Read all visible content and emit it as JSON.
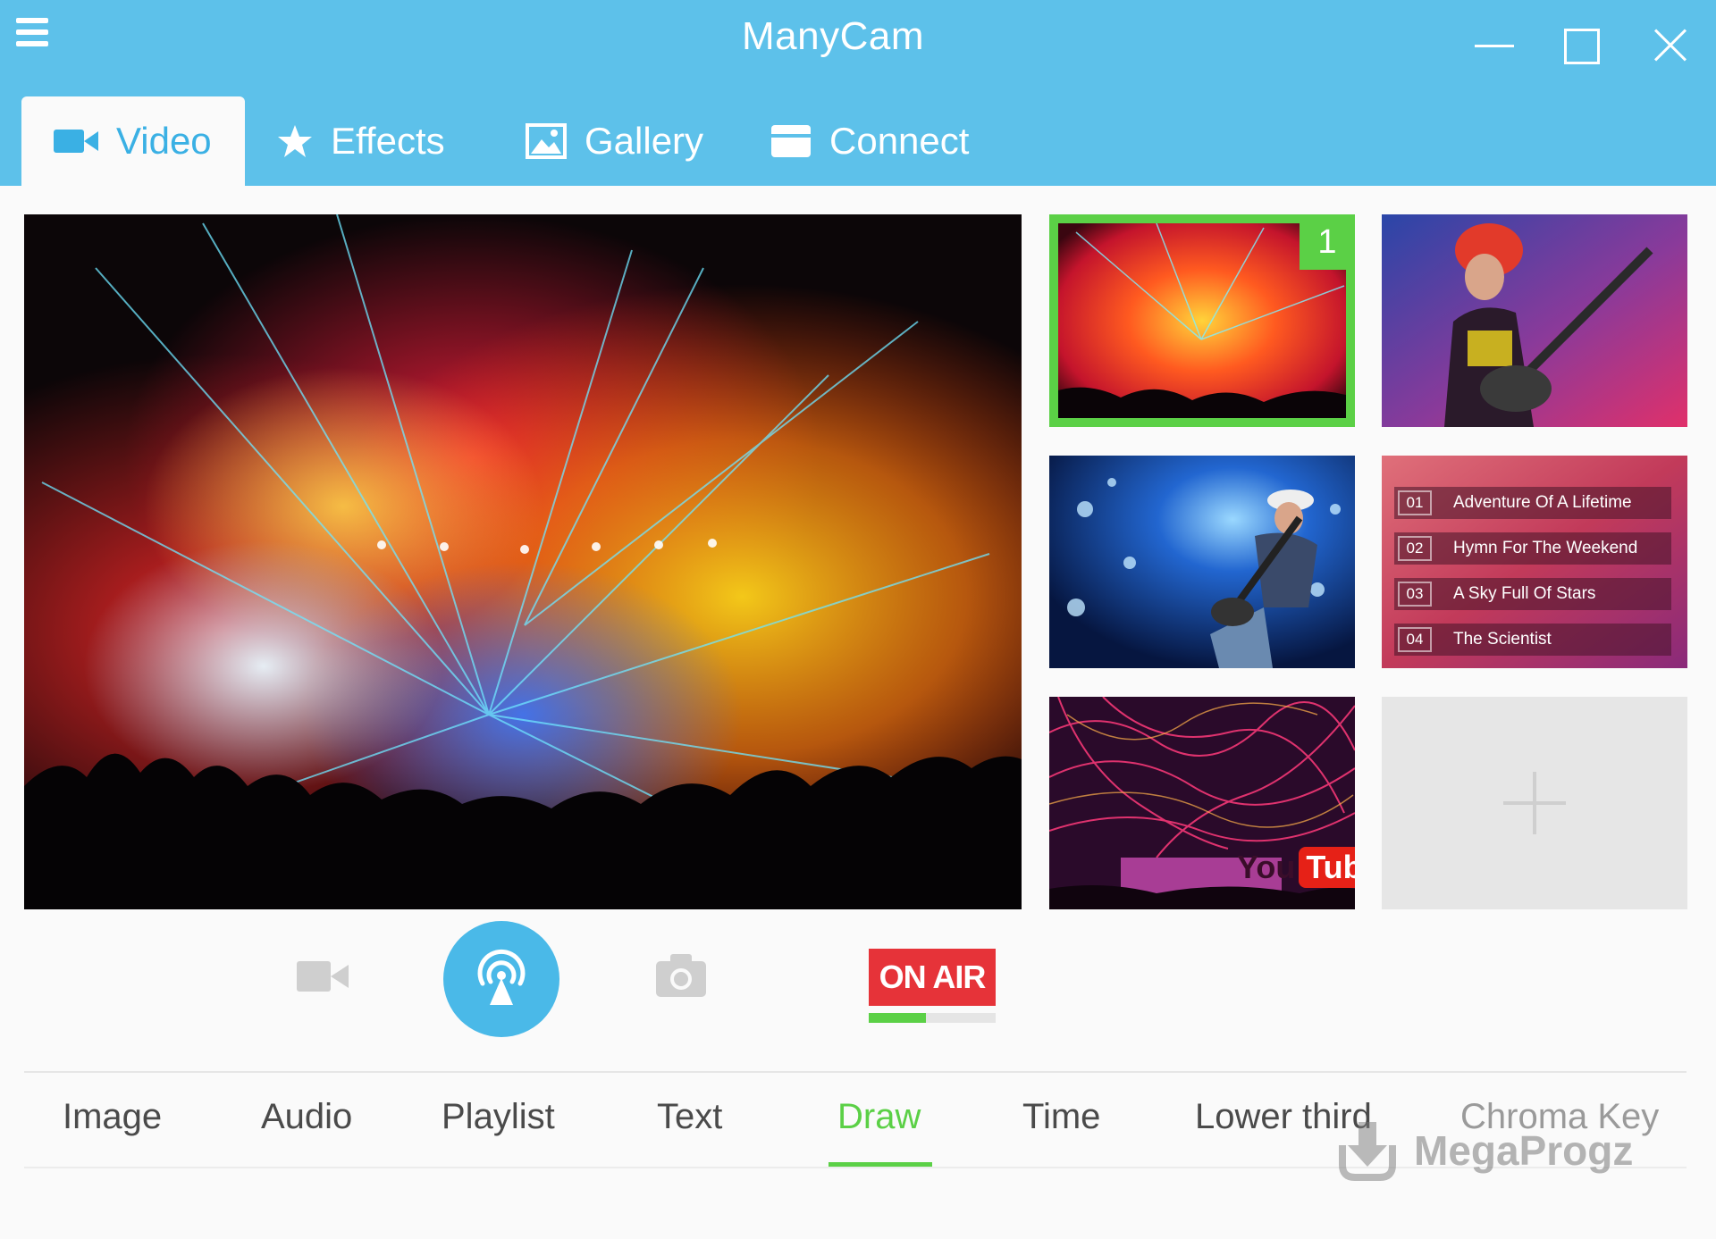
{
  "app": {
    "title": "ManyCam"
  },
  "colors": {
    "title_bar": "#5dc1ea",
    "accent_blue": "#3ab0e4",
    "active_green": "#5bd046",
    "on_air_red": "#e63339",
    "placeholder_gray": "#e6e6e6"
  },
  "window_controls": {
    "icons": [
      "minimize-icon",
      "maximize-icon",
      "close-icon"
    ]
  },
  "main_tabs": [
    {
      "label": "Video",
      "icon": "video-camera-icon",
      "active": true
    },
    {
      "label": "Effects",
      "icon": "star-icon",
      "active": false
    },
    {
      "label": "Gallery",
      "icon": "picture-icon",
      "active": false
    },
    {
      "label": "Connect",
      "icon": "connect-icon",
      "active": false
    }
  ],
  "sources": {
    "selected_badge": "1",
    "tiles": [
      {
        "name": "concert-laser-stage",
        "selected": true
      },
      {
        "name": "female-guitarist-singer",
        "selected": false
      },
      {
        "name": "male-guitarist-spotlights",
        "selected": false
      },
      {
        "name": "playlist",
        "selected": false
      },
      {
        "name": "youtube-concert",
        "selected": false
      },
      {
        "name": "add-source",
        "selected": false
      }
    ],
    "playlist": [
      {
        "num": "01",
        "title": "Adventure Of A Lifetime"
      },
      {
        "num": "02",
        "title": "Hymn For The Weekend"
      },
      {
        "num": "03",
        "title": "A Sky Full Of Stars"
      },
      {
        "num": "04",
        "title": "The Scientist"
      }
    ],
    "youtube": {
      "you": "You",
      "tube": "Tube"
    }
  },
  "controls": {
    "on_air_label": "ON AIR",
    "level_percent": 45,
    "icons": [
      "video-record-icon",
      "broadcast-icon",
      "snapshot-camera-icon"
    ]
  },
  "bottom_tabs": [
    {
      "label": "Image",
      "active": false
    },
    {
      "label": "Audio",
      "active": false
    },
    {
      "label": "Playlist",
      "active": false
    },
    {
      "label": "Text",
      "active": false
    },
    {
      "label": "Draw",
      "active": true
    },
    {
      "label": "Time",
      "active": false
    },
    {
      "label": "Lower third",
      "active": false
    },
    {
      "label": "Chroma Key",
      "active": false
    }
  ],
  "watermark": {
    "text": "MegaProgz"
  }
}
